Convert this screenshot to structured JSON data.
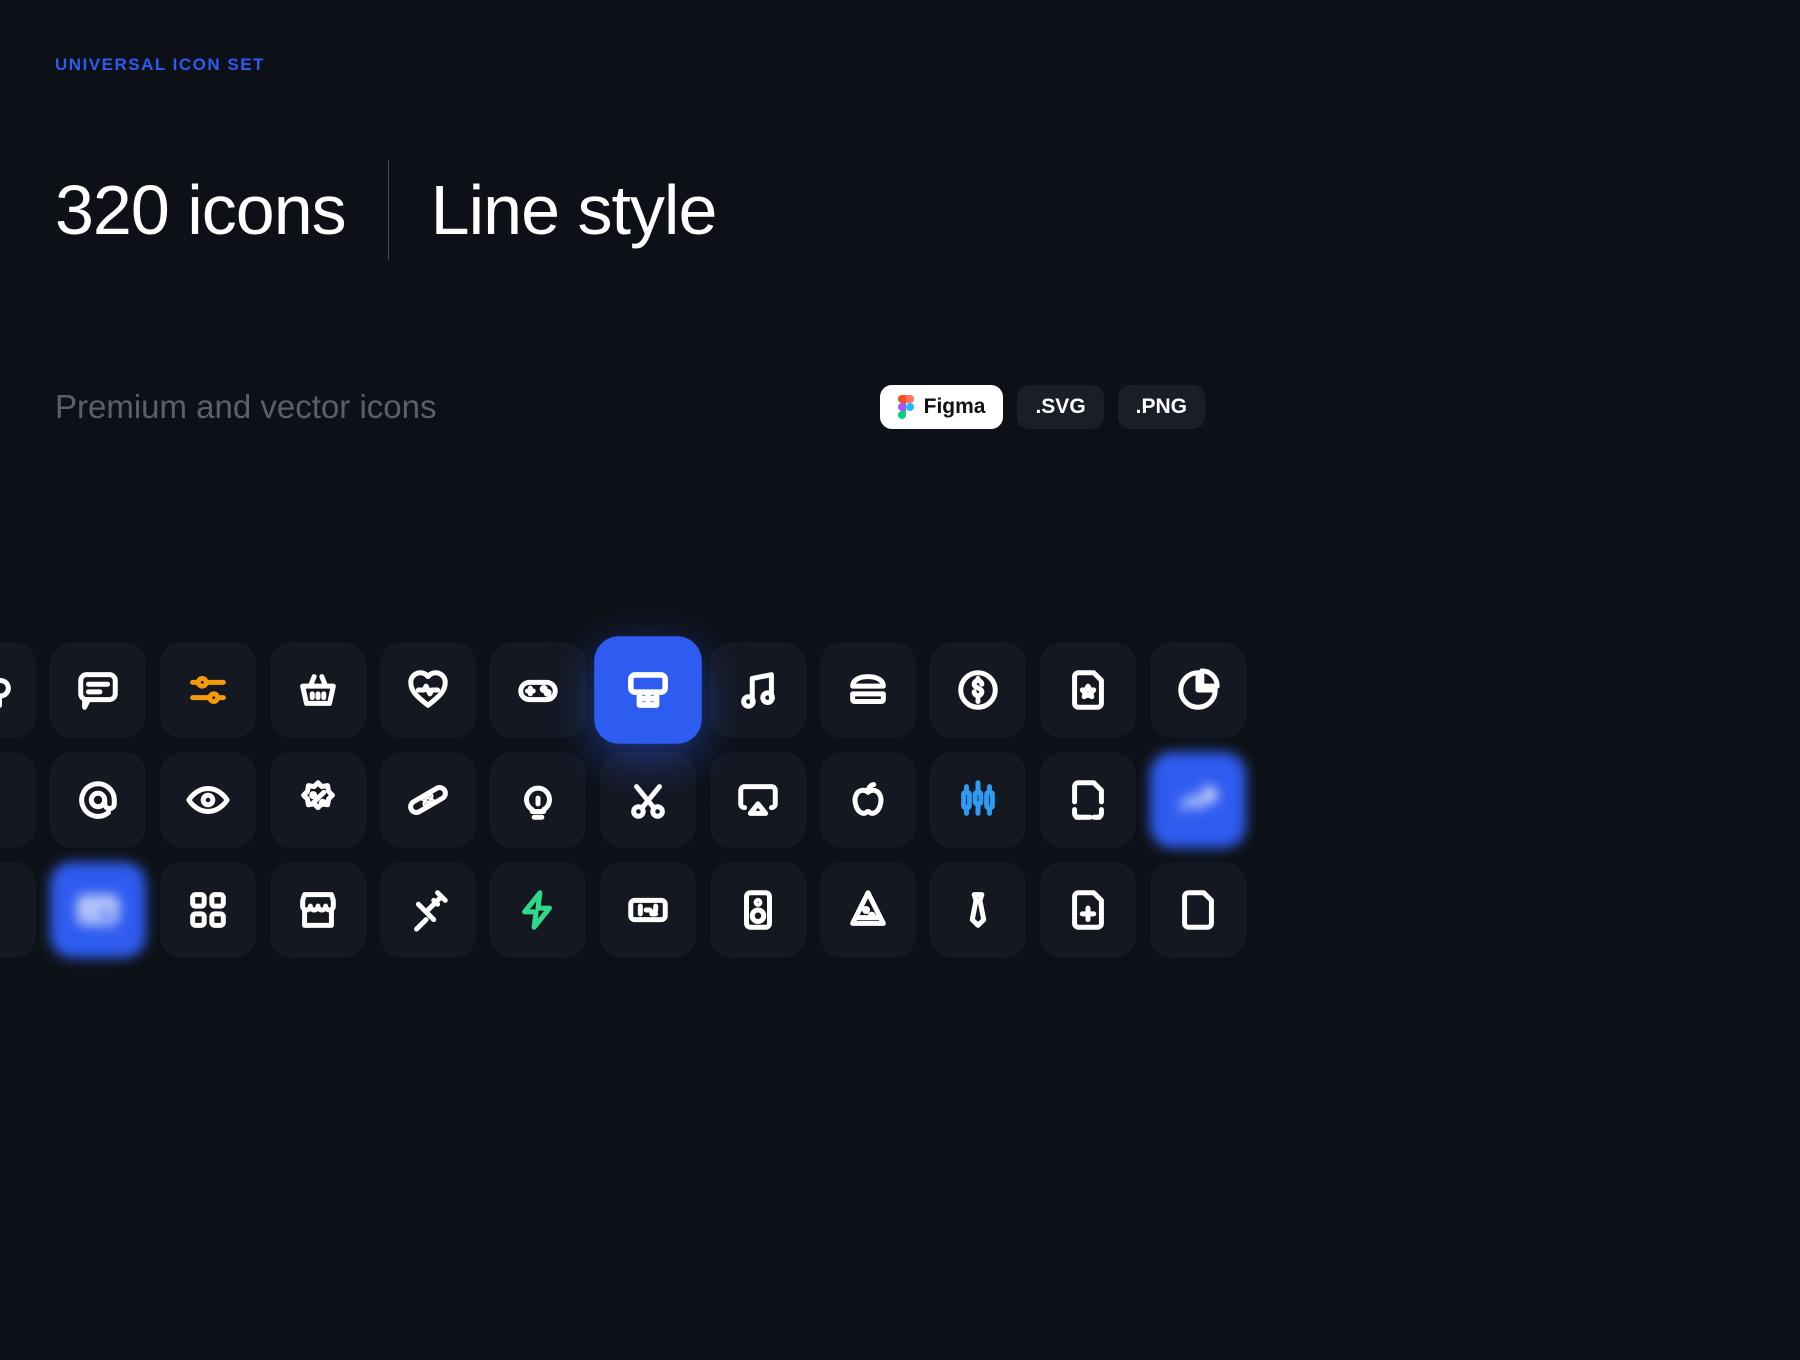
{
  "eyebrow": "UNIVERSAL ICON SET",
  "headline": {
    "left": "320 icons",
    "right": "Line style"
  },
  "subtitle": "Premium and vector icons",
  "badges": {
    "figma": "Figma",
    "svg": ".SVG",
    "png": ".PNG"
  },
  "colors": {
    "accent": "#2f5cf0",
    "sliders": "#f59a0b",
    "candlestick": "#2f9bf0",
    "bolt": "#2fd98c"
  },
  "grid": {
    "row1": [
      "chef-hat",
      "chat",
      "sliders",
      "basket",
      "heartbeat",
      "gamepad",
      "basketball-hoop",
      "music-note",
      "burger",
      "dollar-circle",
      "file-star",
      "pie-chart"
    ],
    "row2": [
      "ice-cream",
      "at-sign",
      "eye",
      "discount-badge",
      "bandage",
      "lightbulb",
      "scissors",
      "airplay",
      "apple",
      "candlestick",
      "file-dashed",
      "trend"
    ],
    "row3": [
      "pear",
      "credit-card",
      "grid-apps",
      "store",
      "syringe",
      "bolt",
      "scoreboard",
      "speaker",
      "pizza-slice",
      "tie",
      "file-plus",
      "file"
    ]
  },
  "highlighted": [
    "basketball-hoop",
    "credit-card",
    "trend"
  ]
}
